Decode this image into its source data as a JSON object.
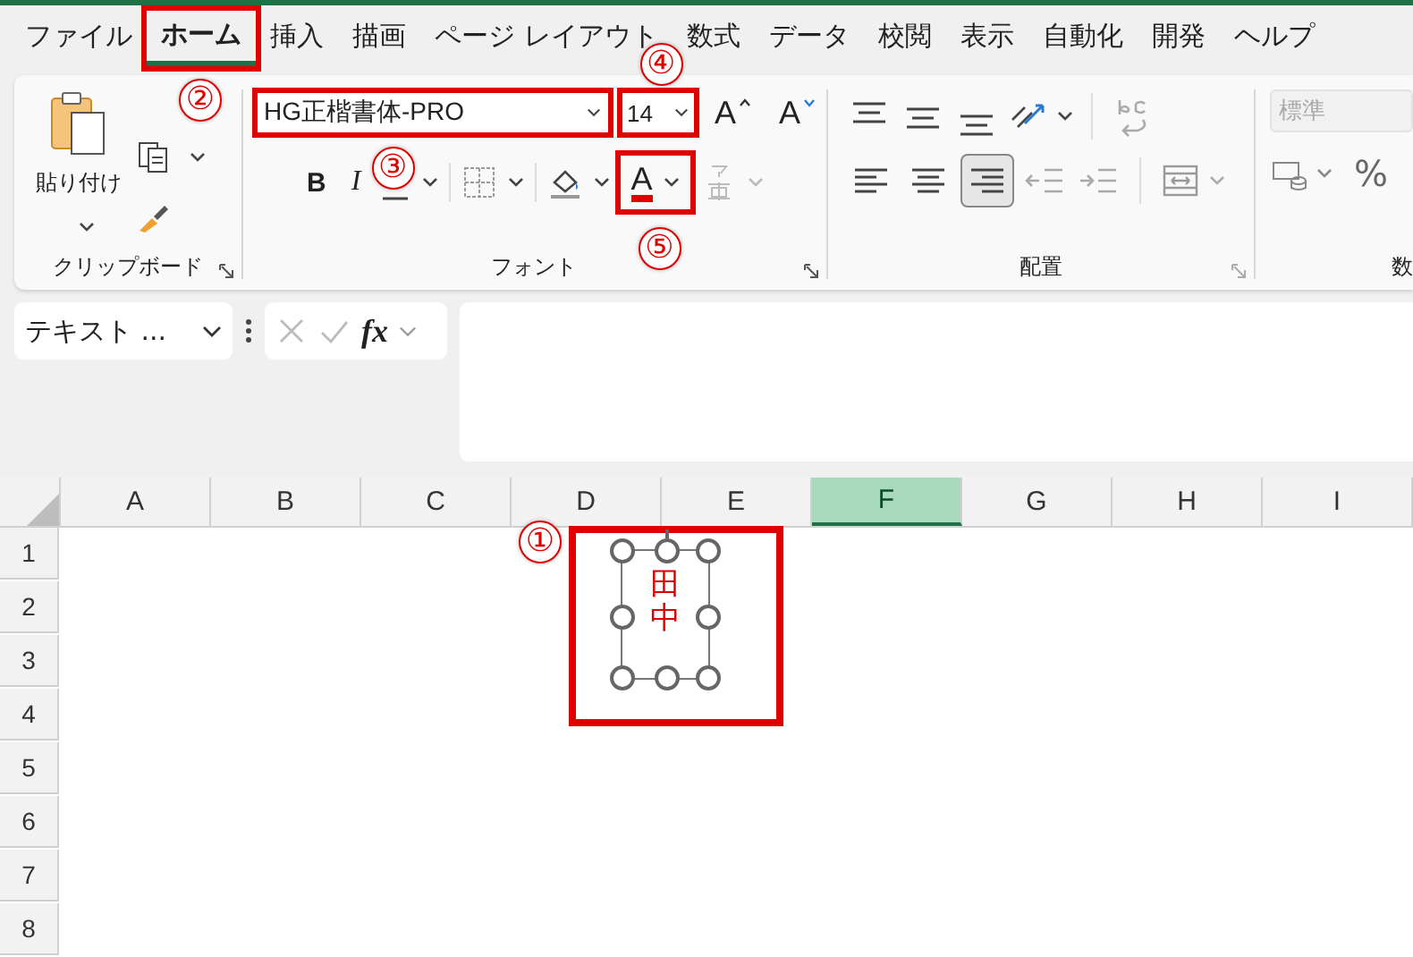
{
  "menu_tabs": [
    {
      "label": "ファイル",
      "selected": false
    },
    {
      "label": "ホーム",
      "selected": true,
      "callout": "②"
    },
    {
      "label": "挿入",
      "selected": false
    },
    {
      "label": "描画",
      "selected": false
    },
    {
      "label": "ページ レイアウト",
      "selected": false
    },
    {
      "label": "数式",
      "selected": false
    },
    {
      "label": "データ",
      "selected": false
    },
    {
      "label": "校閲",
      "selected": false
    },
    {
      "label": "表示",
      "selected": false
    },
    {
      "label": "自動化",
      "selected": false
    },
    {
      "label": "開発",
      "selected": false
    },
    {
      "label": "ヘルプ",
      "selected": false
    }
  ],
  "clipboard": {
    "paste_label": "貼り付け",
    "group_label": "クリップボード"
  },
  "font": {
    "name": {
      "value": "HG正楷書体-PRO",
      "callout": "③"
    },
    "size": {
      "value": "14",
      "callout": "④"
    },
    "grow": "A",
    "shrink": "A",
    "bold": "B",
    "italic": "I",
    "color_button": {
      "letter": "A",
      "callout": "⑤"
    },
    "furigana_disabled": true,
    "group_label": "フォント"
  },
  "alignment": {
    "vertical": [
      {
        "kind": "top",
        "selected": false
      },
      {
        "kind": "middle",
        "selected": false
      },
      {
        "kind": "bottom",
        "selected": false
      }
    ],
    "horizontal": [
      {
        "kind": "left",
        "selected": false
      },
      {
        "kind": "center",
        "selected": false
      },
      {
        "kind": "right",
        "selected": true
      }
    ],
    "indent": [
      {
        "kind": "decrease",
        "disabled": true
      },
      {
        "kind": "increase",
        "disabled": true
      }
    ],
    "wrap_disabled": true,
    "merge_disabled": true,
    "group_label": "配置"
  },
  "number": {
    "format": {
      "value": "標準",
      "disabled": true
    },
    "percent": "%",
    "group_label": "数"
  },
  "formula_bar": {
    "name_box": "テキスト ...",
    "fx": "fx"
  },
  "columns": [
    {
      "label": "A",
      "selected": false
    },
    {
      "label": "B",
      "selected": false
    },
    {
      "label": "C",
      "selected": false
    },
    {
      "label": "D",
      "selected": false
    },
    {
      "label": "E",
      "selected": false
    },
    {
      "label": "F",
      "selected": true
    },
    {
      "label": "G",
      "selected": false
    },
    {
      "label": "H",
      "selected": false
    },
    {
      "label": "I",
      "selected": false
    }
  ],
  "rows": [
    "1",
    "2",
    "3",
    "4",
    "5",
    "6",
    "7",
    "8"
  ],
  "text_box": {
    "text": "田中",
    "selected": true,
    "callout": "①"
  }
}
